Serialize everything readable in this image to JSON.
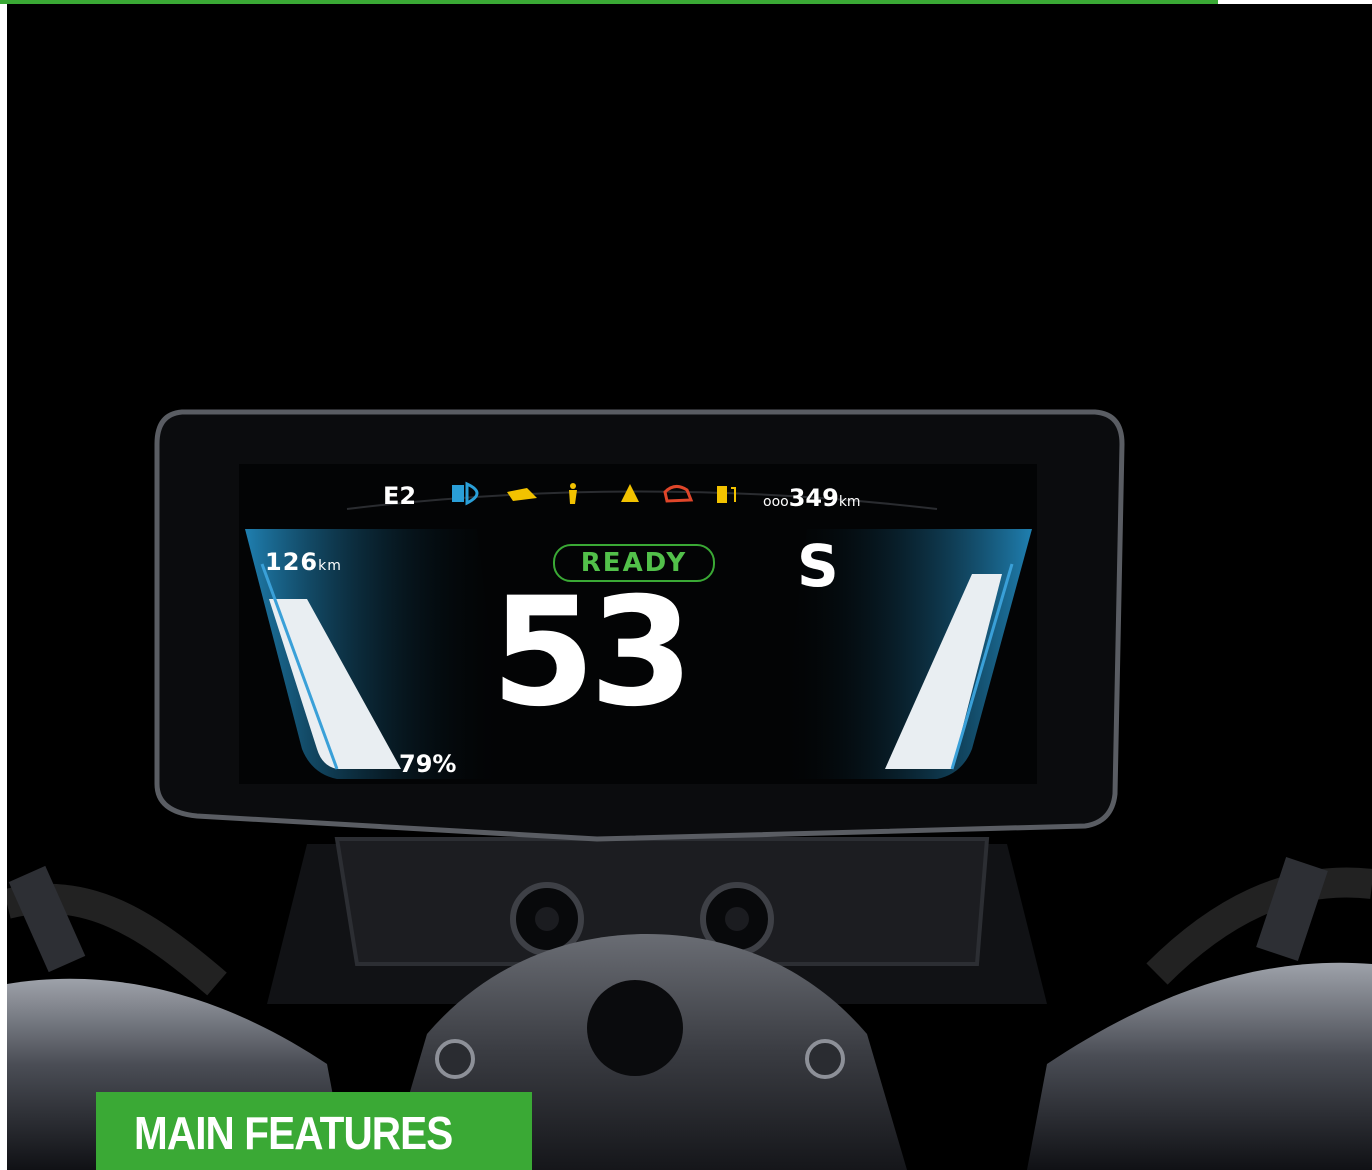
{
  "dashboard": {
    "trip_range": "126",
    "trip_range_unit": "km",
    "battery": "79%",
    "odometer_prefix": "ooo",
    "odometer": "349",
    "odometer_unit": "km",
    "mode_code": "E2",
    "ready_label": "READY",
    "gear": "S",
    "speed": "53",
    "indicators": [
      {
        "name": "headlight-icon",
        "color": "#2a9fd8"
      },
      {
        "name": "engine-oil-icon",
        "color": "#f2c200"
      },
      {
        "name": "side-stand-icon",
        "color": "#f2c200"
      },
      {
        "name": "warning-icon",
        "color": "#f2c200"
      },
      {
        "name": "motor-fault-icon",
        "color": "#e0462a"
      },
      {
        "name": "charging-icon",
        "color": "#f2c200"
      }
    ]
  },
  "badge": {
    "label": "MAIN FEATURES",
    "color": "#3aa935"
  },
  "accent_color": "#3aa935"
}
